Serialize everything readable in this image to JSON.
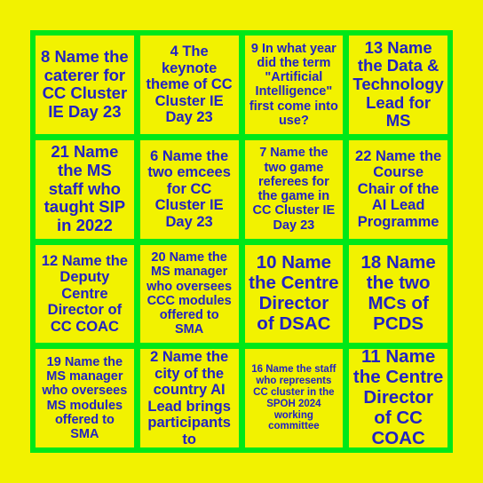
{
  "card": {
    "type": "bingo-card",
    "rows": 4,
    "columns": 4,
    "colors": {
      "background": "#f2f200",
      "grid_border": "#00e818",
      "cell_background": "#f2f200",
      "text": "#2222c4"
    },
    "cells": [
      {
        "number": "8",
        "text": "8 Name the caterer for CC Cluster IE Day 23",
        "size": "lg"
      },
      {
        "number": "4",
        "text": "4 The keynote theme of CC Cluster IE Day 23",
        "size": "md"
      },
      {
        "number": "9",
        "text": "9 In what year did the term \"Artificial Intelligence\" first come into use?",
        "size": "sm"
      },
      {
        "number": "13",
        "text": "13 Name the Data & Technology Lead for MS",
        "size": "lg"
      },
      {
        "number": "21",
        "text": "21 Name the MS staff who taught SIP in 2022",
        "size": "lg"
      },
      {
        "number": "6",
        "text": "6 Name the two emcees for CC Cluster IE Day 23",
        "size": "md"
      },
      {
        "number": "7",
        "text": "7 Name the two game referees for the game in CC Cluster IE Day 23",
        "size": "sm"
      },
      {
        "number": "22",
        "text": "22 Name the Course Chair of the AI Lead Programme",
        "size": "md"
      },
      {
        "number": "12",
        "text": "12 Name the Deputy Centre Director of CC COAC",
        "size": "md"
      },
      {
        "number": "20",
        "text": "20 Name the MS manager who oversees CCC modules offered to SMA",
        "size": "sm"
      },
      {
        "number": "10",
        "text": "10 Name the Centre Director of DSAC",
        "size": "xl"
      },
      {
        "number": "18",
        "text": "18 Name the two MCs of PCDS",
        "size": "xl"
      },
      {
        "number": "19",
        "text": "19 Name the MS manager who oversees MS modules offered to SMA",
        "size": "sm"
      },
      {
        "number": "2",
        "text": "2 Name the city of the country AI Lead brings participants to",
        "size": "md"
      },
      {
        "number": "16",
        "text": "16 Name the staff who represents CC cluster in the SPOH 2024 working committee",
        "size": "xs"
      },
      {
        "number": "11",
        "text": "11 Name the Centre Director of CC COAC",
        "size": "xl"
      }
    ]
  }
}
